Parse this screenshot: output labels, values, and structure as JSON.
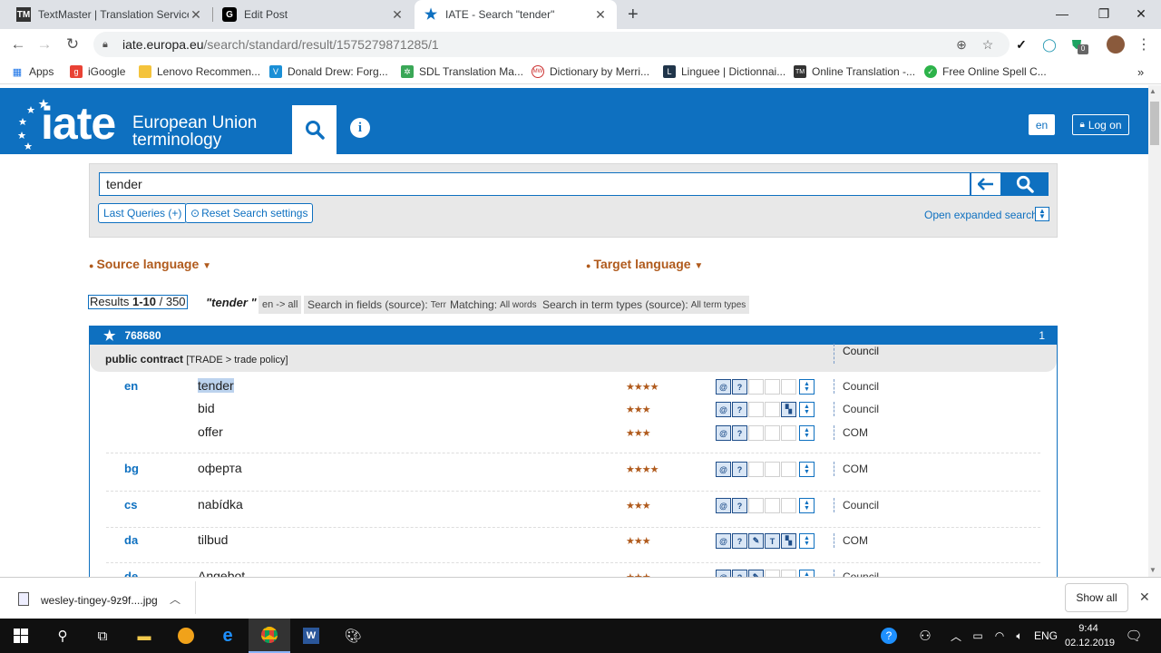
{
  "browser": {
    "tabs": [
      {
        "title": "TextMaster | Translation Service |",
        "favicon": "TM"
      },
      {
        "title": "Edit Post",
        "favicon": "G"
      },
      {
        "title": "IATE - Search \"tender\"",
        "favicon": "★"
      }
    ],
    "new_tab": "+",
    "url_domain": "iate.europa.eu",
    "url_path": "/search/standard/result/1575279871285/1",
    "bookmarks": [
      "Apps",
      "iGoogle",
      "Lenovo Recommen...",
      "Donald Drew: Forg...",
      "SDL Translation Ma...",
      "Dictionary by Merri...",
      "Linguee | Dictionnai...",
      "Online Translation -...",
      "Free Online Spell C..."
    ],
    "more_bookmarks": "»",
    "extension_badge": "0"
  },
  "iate": {
    "logo": "iate",
    "eu_line1": "European Union",
    "eu_line2": "terminology",
    "info_label": "i",
    "lang_btn": "en",
    "login_label": "Log on",
    "search_value": "tender",
    "last_queries": "Last Queries (+)",
    "reset": "Reset Search settings",
    "expanded": "Open expanded search",
    "source_language": "Source language",
    "target_language": "Target language",
    "results_prefix": "Results ",
    "results_range": "1-10",
    "results_total": " / 350",
    "query": "\"tender \"",
    "chips": [
      {
        "label": "en -> all",
        "value": ""
      },
      {
        "label": "Search in fields (source):",
        "value": "Term"
      },
      {
        "label": "Matching:",
        "value": "All words"
      },
      {
        "label": "Search in term types (source):",
        "value": "All term types"
      }
    ],
    "entry": {
      "id": "768680",
      "count": "1",
      "domain_title": "public contract",
      "domain_path": "[TRADE > trade policy]",
      "domain_source": "Council",
      "rows": [
        {
          "lang": "en",
          "term": "tender",
          "stars": "★★★★",
          "source": "Council"
        },
        {
          "lang": "",
          "term": "bid",
          "stars": "★★★",
          "source": "Council"
        },
        {
          "lang": "",
          "term": "offer",
          "stars": "★★★",
          "source": "COM"
        },
        {
          "lang": "bg",
          "term": "оферта",
          "stars": "★★★★",
          "source": "COM"
        },
        {
          "lang": "cs",
          "term": "nabídka",
          "stars": "★★★",
          "source": "Council"
        },
        {
          "lang": "da",
          "term": "tilbud",
          "stars": "★★★",
          "source": "COM"
        },
        {
          "lang": "de",
          "term": "Angebot",
          "stars": "★★★",
          "source": "Council"
        }
      ]
    }
  },
  "downloads": {
    "file": "wesley-tingey-9z9f....jpg",
    "show_all": "Show all"
  },
  "taskbar": {
    "lang": "ENG",
    "time": "9:44",
    "date": "02.12.2019"
  },
  "colors": {
    "iate_blue": "#0e70c0",
    "stars": "#b05a1c"
  }
}
